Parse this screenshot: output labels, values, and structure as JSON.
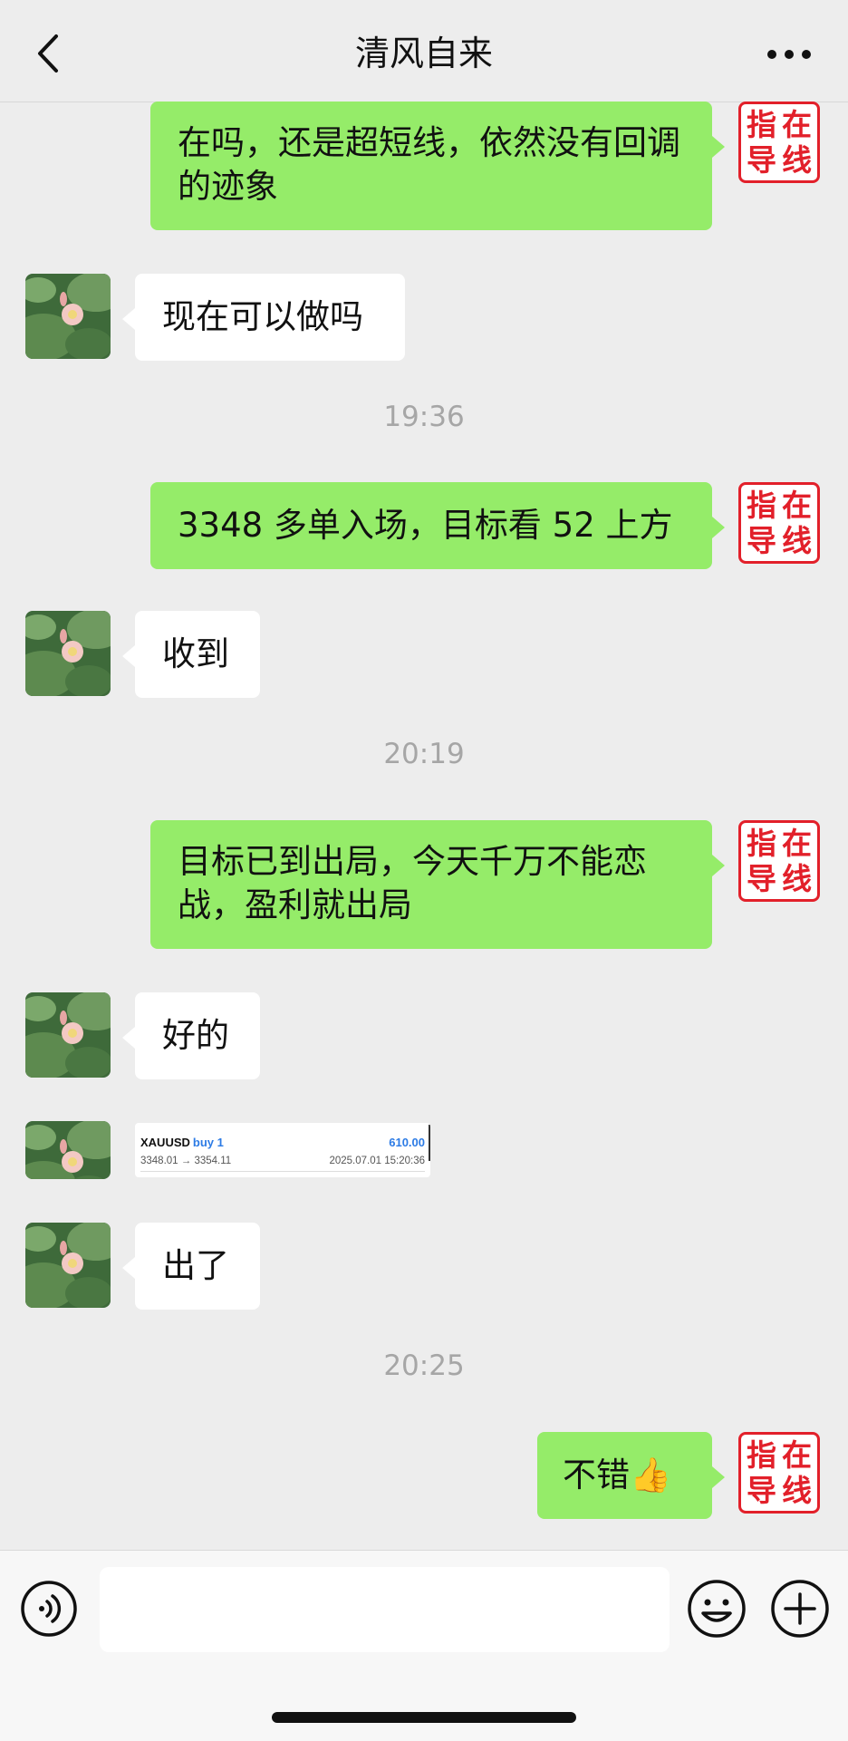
{
  "header": {
    "title": "清风自来"
  },
  "messages": [
    {
      "text": "在吗，还是超短线，依然没有回调的迹象",
      "seal": "指在导线"
    },
    {
      "text": "现在可以做吗"
    },
    {
      "time": "19:36"
    },
    {
      "text": "3348 多单入场，目标看 52 上方",
      "seal": "指在导线"
    },
    {
      "text": "收到"
    },
    {
      "time": "20:19"
    },
    {
      "text": "目标已到出局，今天千万不能恋战，盈利就出局",
      "seal": "指在导线"
    },
    {
      "text": "好的"
    },
    {
      "trade": {
        "symbol": "XAUUSD",
        "direction": "buy 1",
        "profit": "610.00",
        "prices": "3348.01 → 3354.11",
        "time": "2025.07.01 15:20:36"
      }
    },
    {
      "text": "出了"
    },
    {
      "time": "20:25"
    },
    {
      "text": "不错",
      "emoji": "👍",
      "seal": "指在导线"
    }
  ],
  "seal_chars": [
    "指",
    "在",
    "导",
    "线"
  ],
  "colors": {
    "self_bubble": "#95ec69",
    "other_bubble": "#ffffff",
    "seal_red": "#e2202a",
    "background": "#ededed"
  }
}
